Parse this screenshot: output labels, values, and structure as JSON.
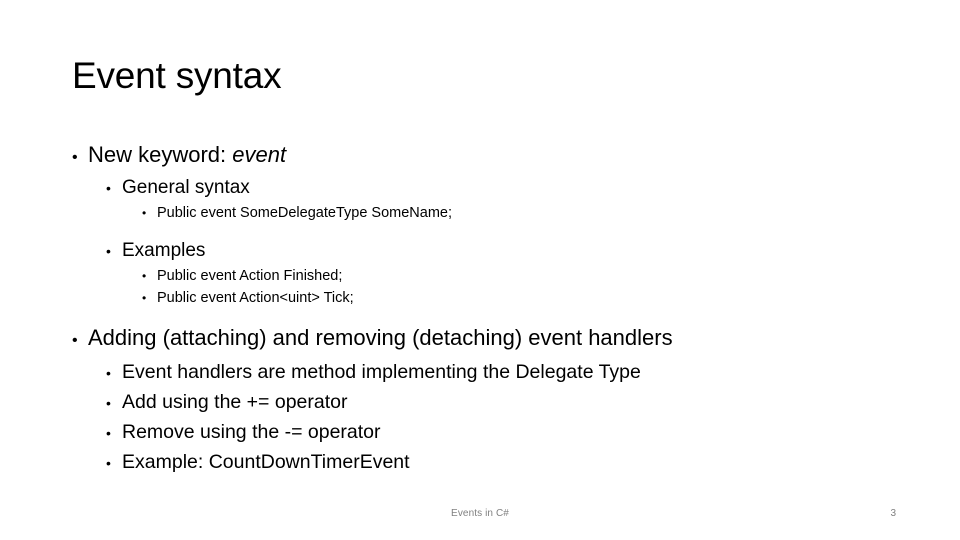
{
  "slide": {
    "title": "Event syntax",
    "bullet_glyph": "•",
    "sections": [
      {
        "name": "new-keyword",
        "items": [
          {
            "level": 1,
            "text_parts": [
              {
                "text": "New keyword: ",
                "style": "normal"
              },
              {
                "text": "event",
                "style": "italic"
              }
            ],
            "plain": "New keyword: event"
          },
          {
            "level": 2,
            "plain": "General syntax"
          },
          {
            "level": 3,
            "plain": "Public event SomeDelegateType SomeName;"
          },
          {
            "level": 2,
            "plain": "Examples"
          },
          {
            "level": 3,
            "plain": "Public event Action Finished;"
          },
          {
            "level": 3,
            "plain": "Public event Action<uint> Tick;"
          }
        ]
      },
      {
        "name": "adding-removing-handlers",
        "items": [
          {
            "level": 1,
            "plain": "Adding (attaching) and removing (detaching) event handlers"
          },
          {
            "level": 2,
            "plain": "Event handlers are method implementing the Delegate Type"
          },
          {
            "level": 2,
            "plain": "Add using the += operator"
          },
          {
            "level": 2,
            "plain": "Remove using the -= operator"
          },
          {
            "level": 2,
            "plain": "Example: CountDownTimerEvent"
          }
        ]
      }
    ]
  },
  "footer": {
    "center_text": "Events in C#",
    "page_number": "3",
    "text_color": "#808080"
  },
  "colors": {
    "background": "#ffffff",
    "text": "#000000",
    "footer": "#808080"
  }
}
